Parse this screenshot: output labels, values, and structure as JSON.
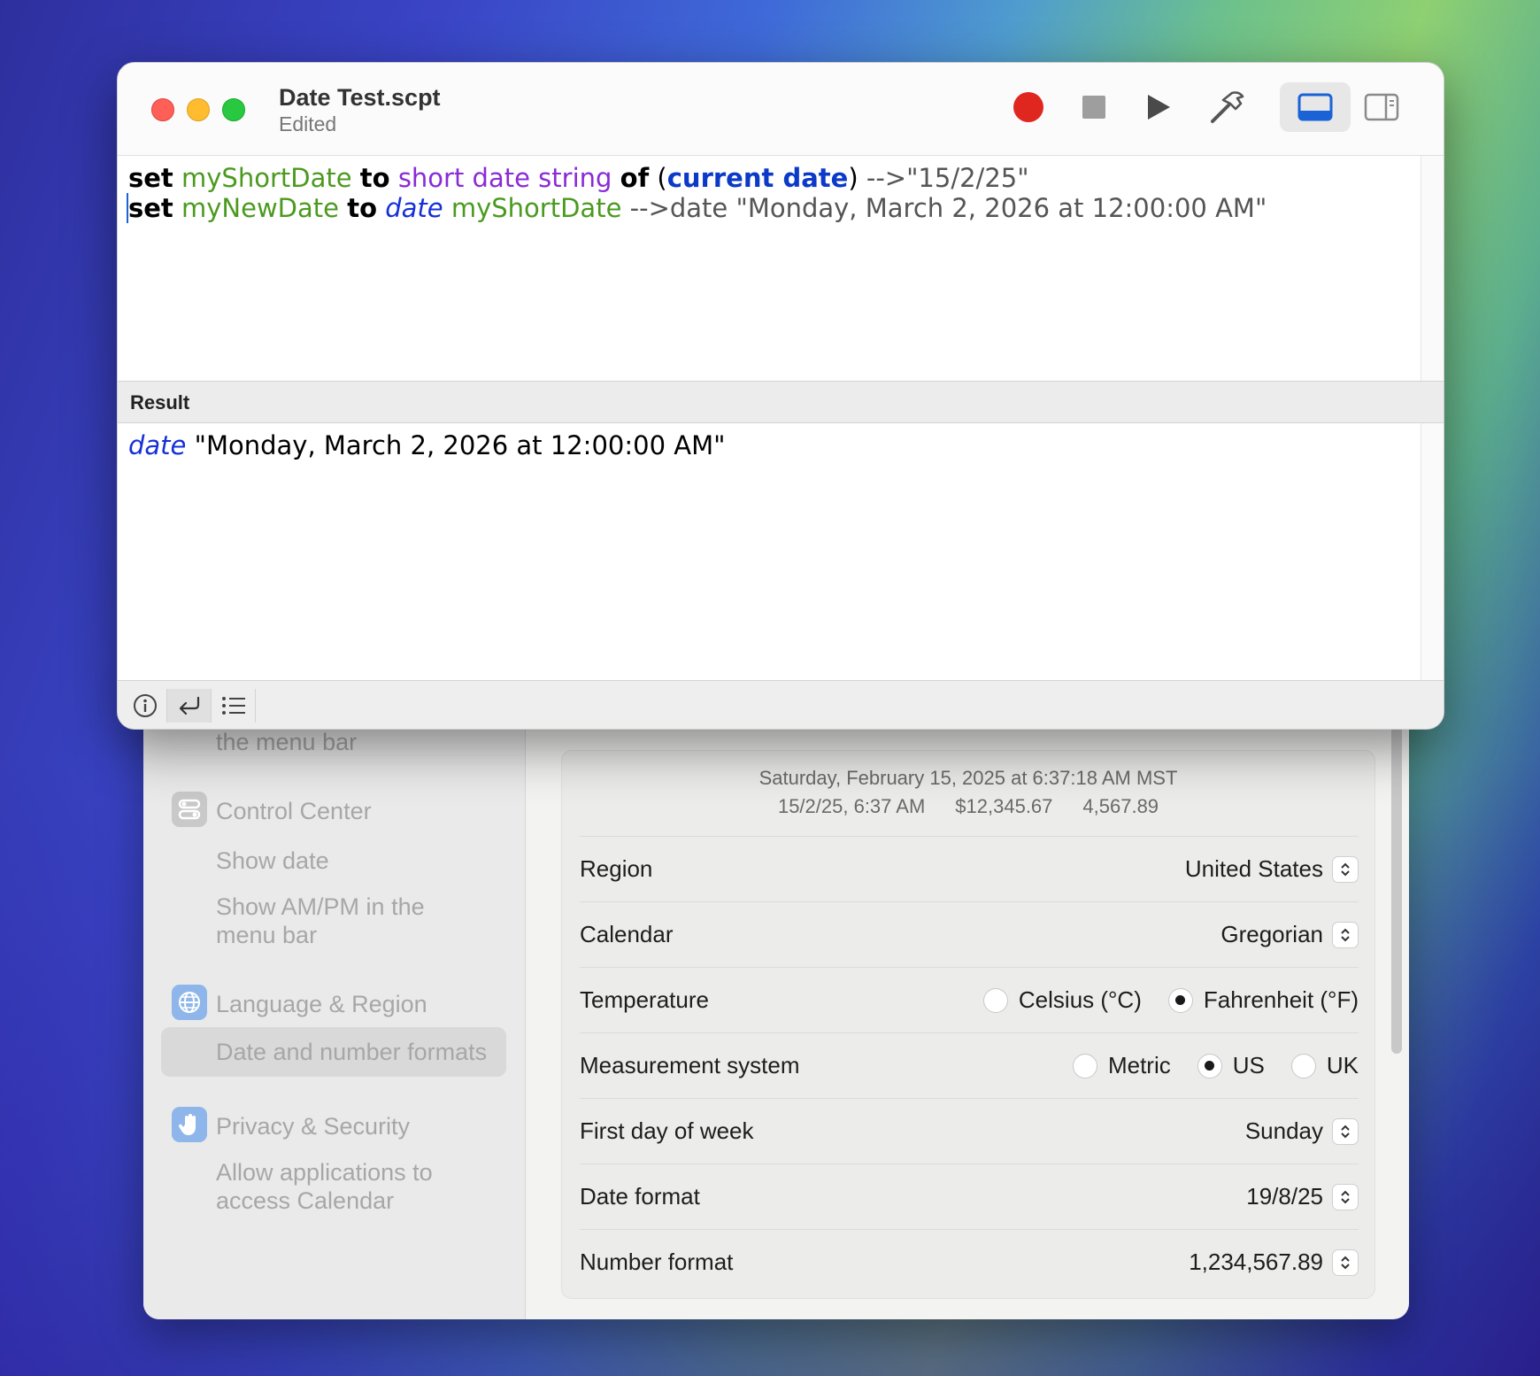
{
  "editor": {
    "title": "Date Test.scpt",
    "subtitle": "Edited",
    "toolbar": {
      "record": "record-icon",
      "stop": "stop-icon",
      "run": "play-icon",
      "compile": "hammer-icon",
      "show_result": "bottom-panel-icon",
      "show_sidebar": "sidebar-icon"
    },
    "script": {
      "line1": {
        "kw_set": "set",
        "var": "myShortDate",
        "kw_to": "to",
        "cmd": "short date string",
        "kw_of": "of",
        "open": "(",
        "app": "current date",
        "close": ")",
        "comment": "-->\"15/2/25\""
      },
      "line2": {
        "kw_set": "set",
        "var": "myNewDate",
        "kw_to": "to",
        "cls": "date",
        "var2": "myShortDate",
        "comment": "-->date \"Monday, March 2, 2026 at 12:00:00 AM\""
      }
    },
    "result_label": "Result",
    "result": {
      "cls": "date",
      "value": "\"Monday, March 2, 2026 at 12:00:00 AM\""
    },
    "bottom_buttons": [
      "info-icon",
      "return-icon",
      "list-icon"
    ]
  },
  "settings": {
    "sidebar": {
      "partial_top": "the menu bar",
      "control_center": "Control Center",
      "show_date": "Show date",
      "show_ampm_1": "Show AM/PM in the",
      "show_ampm_2": "menu bar",
      "language_region": "Language & Region",
      "date_number_formats": "Date and number formats",
      "privacy_security": "Privacy & Security",
      "allow_apps_1": "Allow applications to",
      "allow_apps_2": "access Calendar"
    },
    "preview": {
      "line1": "Saturday, February 15, 2025 at 6:37:18 AM MST",
      "short_date": "15/2/25, 6:37 AM",
      "currency": "$12,345.67",
      "number": "4,567.89"
    },
    "rows": {
      "region": {
        "label": "Region",
        "value": "United States"
      },
      "calendar": {
        "label": "Calendar",
        "value": "Gregorian"
      },
      "temperature": {
        "label": "Temperature",
        "options": [
          "Celsius (°C)",
          "Fahrenheit (°F)"
        ],
        "selected": "Fahrenheit (°F)"
      },
      "measurement": {
        "label": "Measurement system",
        "options": [
          "Metric",
          "US",
          "UK"
        ],
        "selected": "US"
      },
      "first_day": {
        "label": "First day of week",
        "value": "Sunday"
      },
      "date_format": {
        "label": "Date format",
        "value": "19/8/25"
      },
      "number_format": {
        "label": "Number format",
        "value": "1,234,567.89"
      }
    }
  },
  "colors": {
    "record": "#e0271f",
    "accent_blue": "#1a62d6",
    "keyword_var": "#4b9a1f",
    "keyword_cmd": "#8a2bd6"
  }
}
